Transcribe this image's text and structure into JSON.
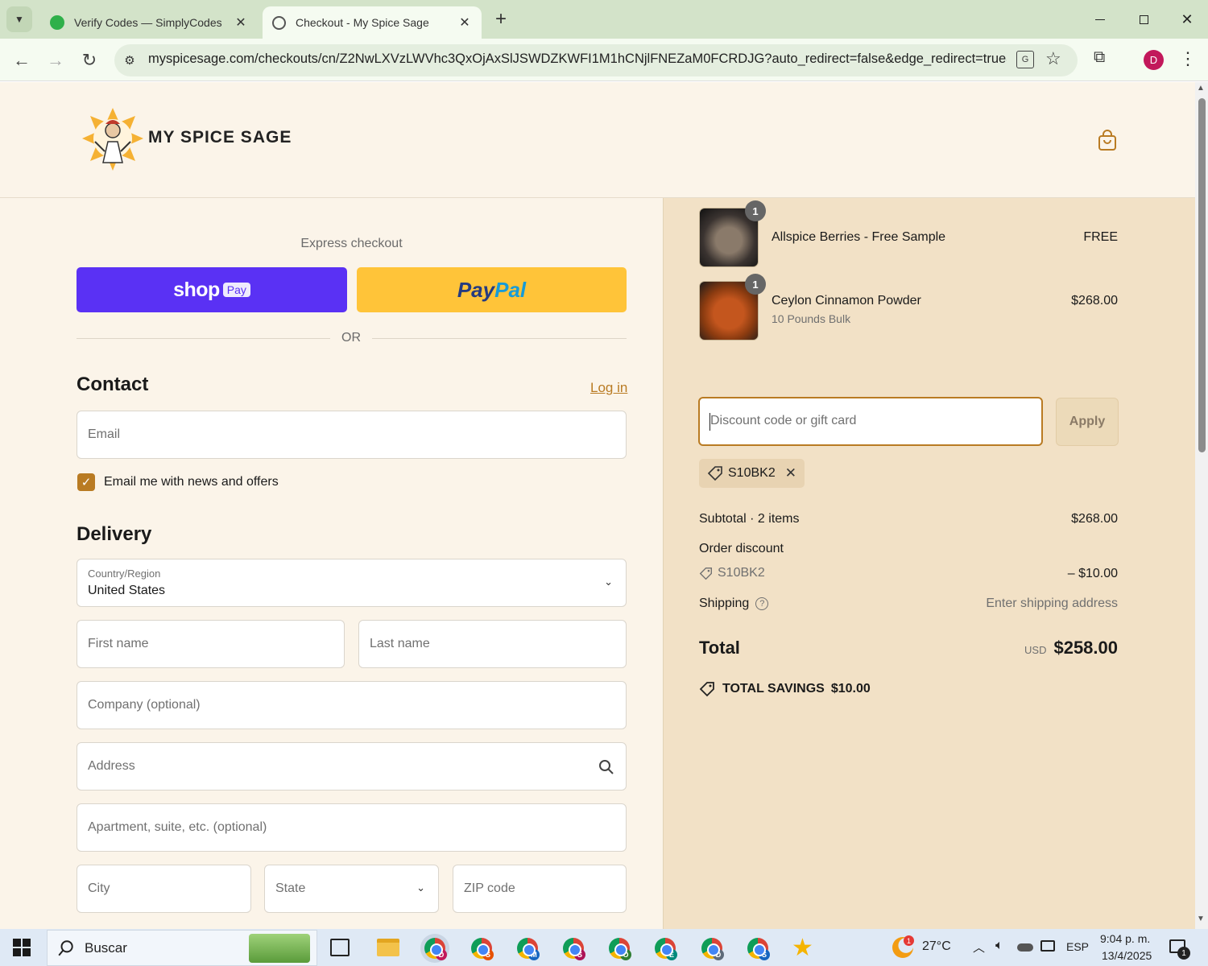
{
  "browser": {
    "tabs": [
      {
        "title": "Verify Codes — SimplyCodes",
        "active": false
      },
      {
        "title": "Checkout - My Spice Sage",
        "active": true
      }
    ],
    "url": "myspicesage.com/checkouts/cn/Z2NwLXVzLWVhc3QxOjAxSlJSWDZKWFI1M1hCNjlFNEZaM0FCRDJG?auto_redirect=false&edge_redirect=true&lo...",
    "profile_initial": "D"
  },
  "store": {
    "name": "MY SPICE SAGE"
  },
  "checkout": {
    "express_label": "Express checkout",
    "shop_pay": {
      "text": "shop",
      "badge": "Pay"
    },
    "paypal": {
      "pay": "Pay",
      "pal": "Pal"
    },
    "or_label": "OR",
    "contact": {
      "heading": "Contact",
      "login_link": "Log in",
      "email_placeholder": "Email",
      "newsletter_label": "Email me with news and offers",
      "newsletter_checked": true
    },
    "delivery": {
      "heading": "Delivery",
      "country_label": "Country/Region",
      "country_value": "United States",
      "first_name": "First name",
      "last_name": "Last name",
      "company": "Company (optional)",
      "address": "Address",
      "apartment": "Apartment, suite, etc. (optional)",
      "city": "City",
      "state": "State",
      "zip": "ZIP code"
    }
  },
  "summary": {
    "items": [
      {
        "name": "Allspice Berries - Free Sample",
        "variant": "",
        "quantity": "1",
        "price": "FREE"
      },
      {
        "name": "Ceylon Cinnamon Powder",
        "variant": "10 Pounds Bulk",
        "quantity": "1",
        "price": "$268.00"
      }
    ],
    "discount_placeholder": "Discount code or gift card",
    "apply_label": "Apply",
    "applied_code": "S10BK2",
    "subtotal_label": "Subtotal · 2 items",
    "subtotal_value": "$268.00",
    "order_discount_label": "Order discount",
    "discount_code": "S10BK2",
    "discount_value": "– $10.00",
    "shipping_label": "Shipping",
    "shipping_value": "Enter shipping address",
    "total_label": "Total",
    "currency": "USD",
    "total_value": "$258.00",
    "savings_label": "TOTAL SAVINGS",
    "savings_value": "$10.00"
  },
  "taskbar": {
    "search_label": "Buscar",
    "weather_badge": "1",
    "temperature": "27°C",
    "language": "ESP",
    "time": "9:04 p. m.",
    "date": "13/4/2025",
    "notification_count": "1",
    "chrome_badges": [
      "D",
      "S",
      "M",
      "S",
      "O",
      "E",
      "D",
      "S"
    ]
  },
  "colors": {
    "accent": "#b97b23",
    "shop_pay": "#5a31f4",
    "paypal": "#ffc439",
    "summary_bg": "#f2e1c6",
    "page_bg": "#fbf4e9"
  }
}
